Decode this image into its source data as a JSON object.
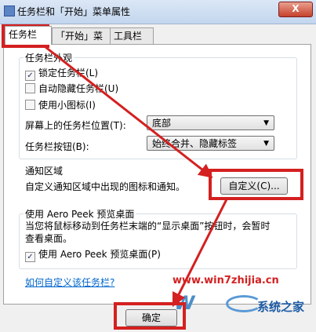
{
  "window": {
    "title": "任务栏和「开始」菜单属性",
    "close_label": "X"
  },
  "tabs": [
    {
      "label": "任务栏",
      "active": true
    },
    {
      "label": "「开始」菜单",
      "active": false
    },
    {
      "label": "工具栏",
      "active": false
    }
  ],
  "appearance": {
    "group_label": "任务栏外观",
    "lock": {
      "label": "锁定任务栏(L)",
      "checked": true,
      "mark": "✓"
    },
    "autohide": {
      "label": "自动隐藏任务栏(U)",
      "checked": false
    },
    "small_icons": {
      "label": "使用小图标(I)",
      "checked": false
    },
    "location": {
      "label": "屏幕上的任务栏位置(T):",
      "value": "底部"
    },
    "buttons": {
      "label": "任务栏按钮(B):",
      "value": "始终合并、隐藏标签"
    }
  },
  "notification": {
    "group_label": "通知区域",
    "description": "自定义通知区域中出现的图标和通知。",
    "customize_label": "自定义(C)..."
  },
  "peek": {
    "group_label": "使用 Aero Peek 预览桌面",
    "description_line1": "当您将鼠标移动到任务栏末端的“显示桌面”按钮时，会暂时",
    "description_line2": "查看桌面。",
    "checkbox": {
      "label": "使用 Aero Peek 预览桌面(P)",
      "checked": true,
      "mark": "✓"
    }
  },
  "help_link": "如何自定义该任务栏?",
  "ok_label": "确定",
  "watermark": {
    "url": "www.win7zhijia.cn",
    "brand": "系统之家"
  },
  "colors": {
    "annotation_red": "#d42020",
    "link_blue": "#0066cc",
    "title_bar": "#c3d6ee"
  }
}
